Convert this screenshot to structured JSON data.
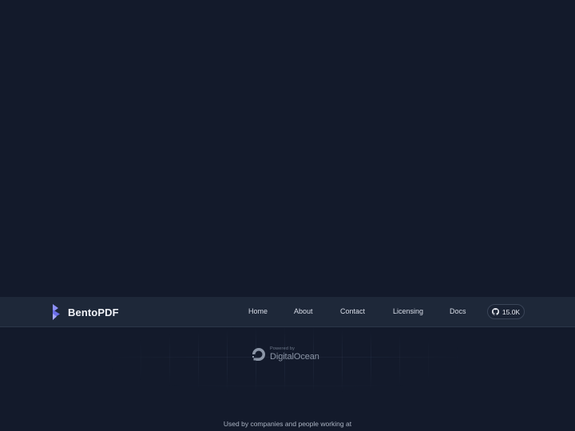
{
  "brand": {
    "name": "BentoPDF",
    "logo_icon": "bento-logo-icon",
    "accent": "#7c83f5"
  },
  "nav": {
    "items": [
      {
        "label": "Home"
      },
      {
        "label": "About"
      },
      {
        "label": "Contact"
      },
      {
        "label": "Licensing"
      },
      {
        "label": "Docs"
      }
    ],
    "github": {
      "icon": "github-icon",
      "stars": "15.0K"
    }
  },
  "hero": {
    "sponsor": {
      "small_label": "Powered by",
      "name": "DigitalOcean",
      "icon": "digitalocean-logo-icon"
    },
    "used_by": "Used by companies and people working at"
  },
  "colors": {
    "background": "#131a2b",
    "navbar": "#1e2839",
    "text_muted": "#aab3c2"
  }
}
